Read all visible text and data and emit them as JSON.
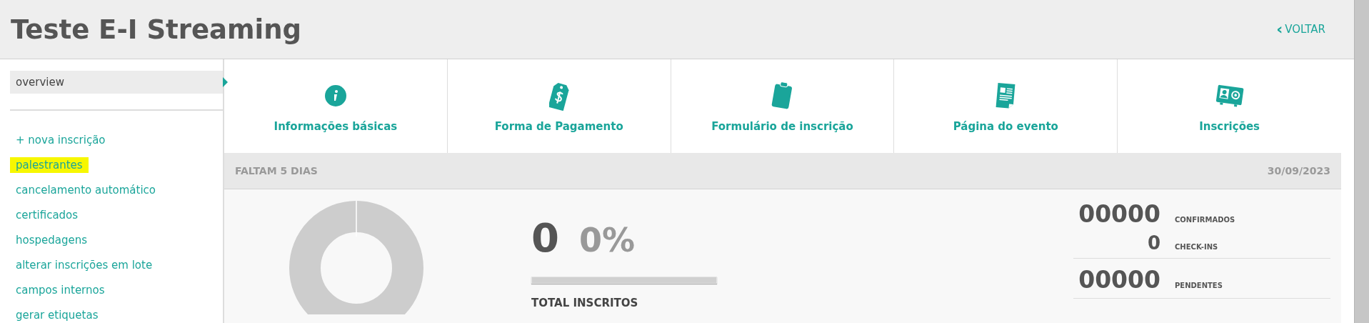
{
  "header": {
    "title": "Teste E-I Streaming",
    "back_link": {
      "icon": "‹",
      "label": "VOLTAR"
    }
  },
  "sidebar": {
    "items": [
      {
        "label": "overview",
        "selected": true,
        "highlighted": false,
        "kind": "tab"
      },
      {
        "label": "+ nova inscrição",
        "selected": false,
        "highlighted": false,
        "kind": "link"
      },
      {
        "label": "palestrantes",
        "selected": false,
        "highlighted": true,
        "kind": "link"
      },
      {
        "label": "cancelamento automático",
        "selected": false,
        "highlighted": false,
        "kind": "link"
      },
      {
        "label": "certificados",
        "selected": false,
        "highlighted": false,
        "kind": "link"
      },
      {
        "label": "hospedagens",
        "selected": false,
        "highlighted": false,
        "kind": "link"
      },
      {
        "label": "alterar inscrições em lote",
        "selected": false,
        "highlighted": false,
        "kind": "link"
      },
      {
        "label": "campos internos",
        "selected": false,
        "highlighted": false,
        "kind": "link"
      },
      {
        "label": "gerar etiquetas",
        "selected": false,
        "highlighted": false,
        "kind": "link"
      }
    ]
  },
  "tiles": [
    {
      "label": "Informações básicas"
    },
    {
      "label": "Forma de Pagamento"
    },
    {
      "label": "Formulário de inscrição"
    },
    {
      "label": "Página do evento"
    },
    {
      "label": "Inscrições"
    }
  ],
  "banner": {
    "countdown": "FALTAM 5 DIAS",
    "date": "30/09/2023"
  },
  "summary": {
    "total": "0",
    "percent": "0%",
    "level": 0,
    "total_label": "TOTAL INSCRITOS",
    "stats": [
      {
        "value": "00000",
        "label": "CONFIRMADOS"
      },
      {
        "value": "0",
        "label": "CHECK-INS"
      },
      {
        "value": "00000",
        "label": "PENDENTES"
      }
    ]
  }
}
